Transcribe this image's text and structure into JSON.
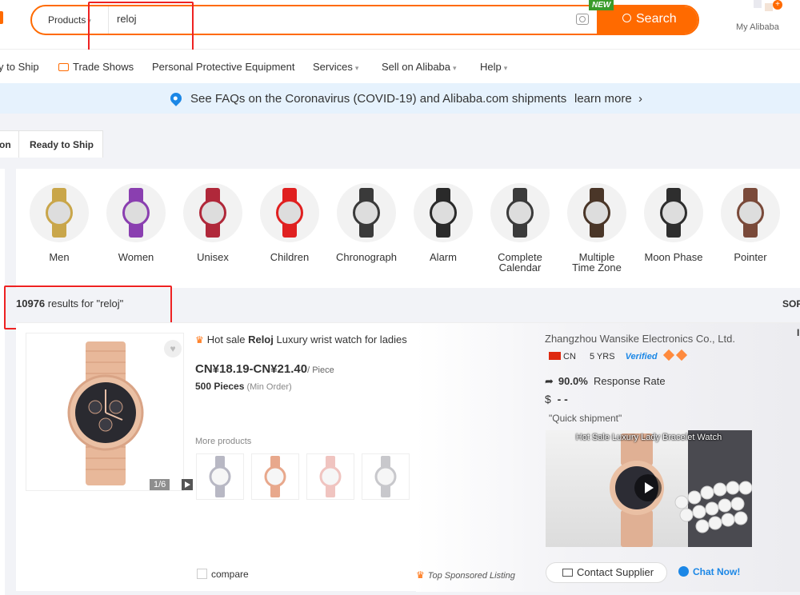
{
  "search": {
    "category": "Products",
    "query": "reloj",
    "button_label": "Search",
    "new_badge": "NEW"
  },
  "account": {
    "label": "My Alibaba",
    "notif": "+"
  },
  "nav": [
    {
      "label": "y to Ship"
    },
    {
      "label": "Trade Shows"
    },
    {
      "label": "Personal Protective Equipment"
    },
    {
      "label": "Services"
    },
    {
      "label": "Sell on Alibaba"
    },
    {
      "label": "Help"
    }
  ],
  "banner": {
    "text": "See FAQs on the Coronavirus (COVID-19) and Alibaba.com shipments",
    "link": "learn more",
    "link_chevron": "›"
  },
  "tabs": [
    {
      "label": "on"
    },
    {
      "label": "Ready to Ship"
    }
  ],
  "categories": [
    {
      "label": "Men",
      "strap": "#c9a64a",
      "icon": "gold-watch"
    },
    {
      "label": "Women",
      "strap": "#8a3fb0",
      "icon": "purple-watch"
    },
    {
      "label": "Unisex",
      "strap": "#b0283a",
      "icon": "striped-watch"
    },
    {
      "label": "Children",
      "strap": "#e02020",
      "icon": "red-kids-watch"
    },
    {
      "label": "Chronograph",
      "strap": "#3a3a3a",
      "icon": "black-sport-watch"
    },
    {
      "label": "Alarm",
      "strap": "#2a2a2a",
      "icon": "digital-watch"
    },
    {
      "label": "Complete\nCalendar",
      "strap": "#3b3b3b",
      "icon": "silver-watch"
    },
    {
      "label": "Multiple\nTime Zone",
      "strap": "#4a3628",
      "icon": "multi-dial-watch"
    },
    {
      "label": "Moon Phase",
      "strap": "#2e2e2e",
      "icon": "moon-phase-watch"
    },
    {
      "label": "Pointer",
      "strap": "#7a4a3a",
      "icon": "rose-watch"
    }
  ],
  "results": {
    "count": "10976",
    "suffix": " results for \"reloj\"",
    "sort_label": "SOR"
  },
  "product": {
    "title_prefix": "Hot sale ",
    "title_keyword": "Reloj",
    "title_suffix": " Luxury wrist watch for ladies",
    "price": "CN¥18.19-CN¥21.40",
    "price_unit": "/ Piece",
    "moq": "500 Pieces",
    "moq_note": " (Min Order)",
    "image_counter": "1/6",
    "more_products_label": "More products",
    "compare_label": "compare",
    "sponsored_label": "Top Sponsored Listing",
    "thumb_colors": [
      "#b8b8c4",
      "#e8a88c",
      "#f0c4c0",
      "#c8c8cc"
    ]
  },
  "supplier": {
    "name": "Zhangzhou Wansike Electronics Co., Ltd.",
    "country": "CN",
    "years": "5 YRS",
    "verified": "Verified",
    "response_rate": "90.0%",
    "response_label": "Response Rate",
    "revenue_symbol": "$",
    "revenue": "- -",
    "quote": "\"Quick shipment\"",
    "video_title": "Hot Sale Luxury Lady Bracelet Watch",
    "contact_label": "Contact Supplier",
    "chat_label": "Chat Now!"
  },
  "right_edge": "I",
  "colors": {
    "accent": "#ff6a00",
    "link_blue": "#1b87e6",
    "highlight_red": "#ee2222"
  }
}
